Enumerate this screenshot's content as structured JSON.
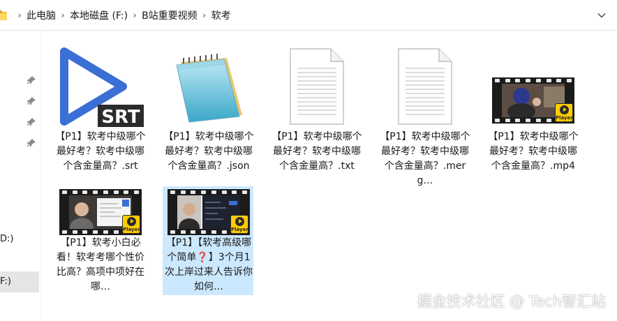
{
  "address_bar": {
    "crumbs": [
      "此电脑",
      "本地磁盘 (F:)",
      "B站重要视频",
      "软考"
    ]
  },
  "nav_pane": {
    "items": [
      "D:)",
      "F:)"
    ],
    "selected": "F:)"
  },
  "files": [
    {
      "name": "【P1】软考中级哪个最好考？软考中级哪个含金量高？.srt",
      "type": "srt",
      "icon": "srt-play-icon",
      "badge": "SRT"
    },
    {
      "name": "【P1】软考中级哪个最好考？软考中级哪个含金量高？.json",
      "type": "json",
      "icon": "notepad-icon"
    },
    {
      "name": "【P1】软考中级哪个最好考？软考中级哪个含金量高？.txt",
      "type": "txt",
      "icon": "document-icon"
    },
    {
      "name": "【P1】软考中级哪个最好考？软考中级哪个含金量高？.merg…",
      "type": "merge",
      "icon": "document-icon"
    },
    {
      "name": "【P1】软考中级哪个最好考？软考中级哪个含金量高？.mp4",
      "type": "mp4",
      "icon": "video-thumbnail",
      "badge": "Player"
    },
    {
      "name": "【P1】软考小白必看！软考考哪个性价比高？高项中项好在哪…",
      "type": "mp4",
      "icon": "video-thumbnail",
      "badge": "Player"
    },
    {
      "name": "【P1】【软考高级哪个简单❓】3个月1次上岸过来人告诉你如何…",
      "type": "mp4",
      "icon": "video-thumbnail",
      "badge": "Player",
      "selected": true
    }
  ],
  "watermark": "掘金技术社区 @ Tech智汇站",
  "colors": {
    "selection": "#cce8ff",
    "nav_selection": "#e5e5e5",
    "srt_blue": "#3b6fd6",
    "player_yellow": "#ffcc00"
  }
}
